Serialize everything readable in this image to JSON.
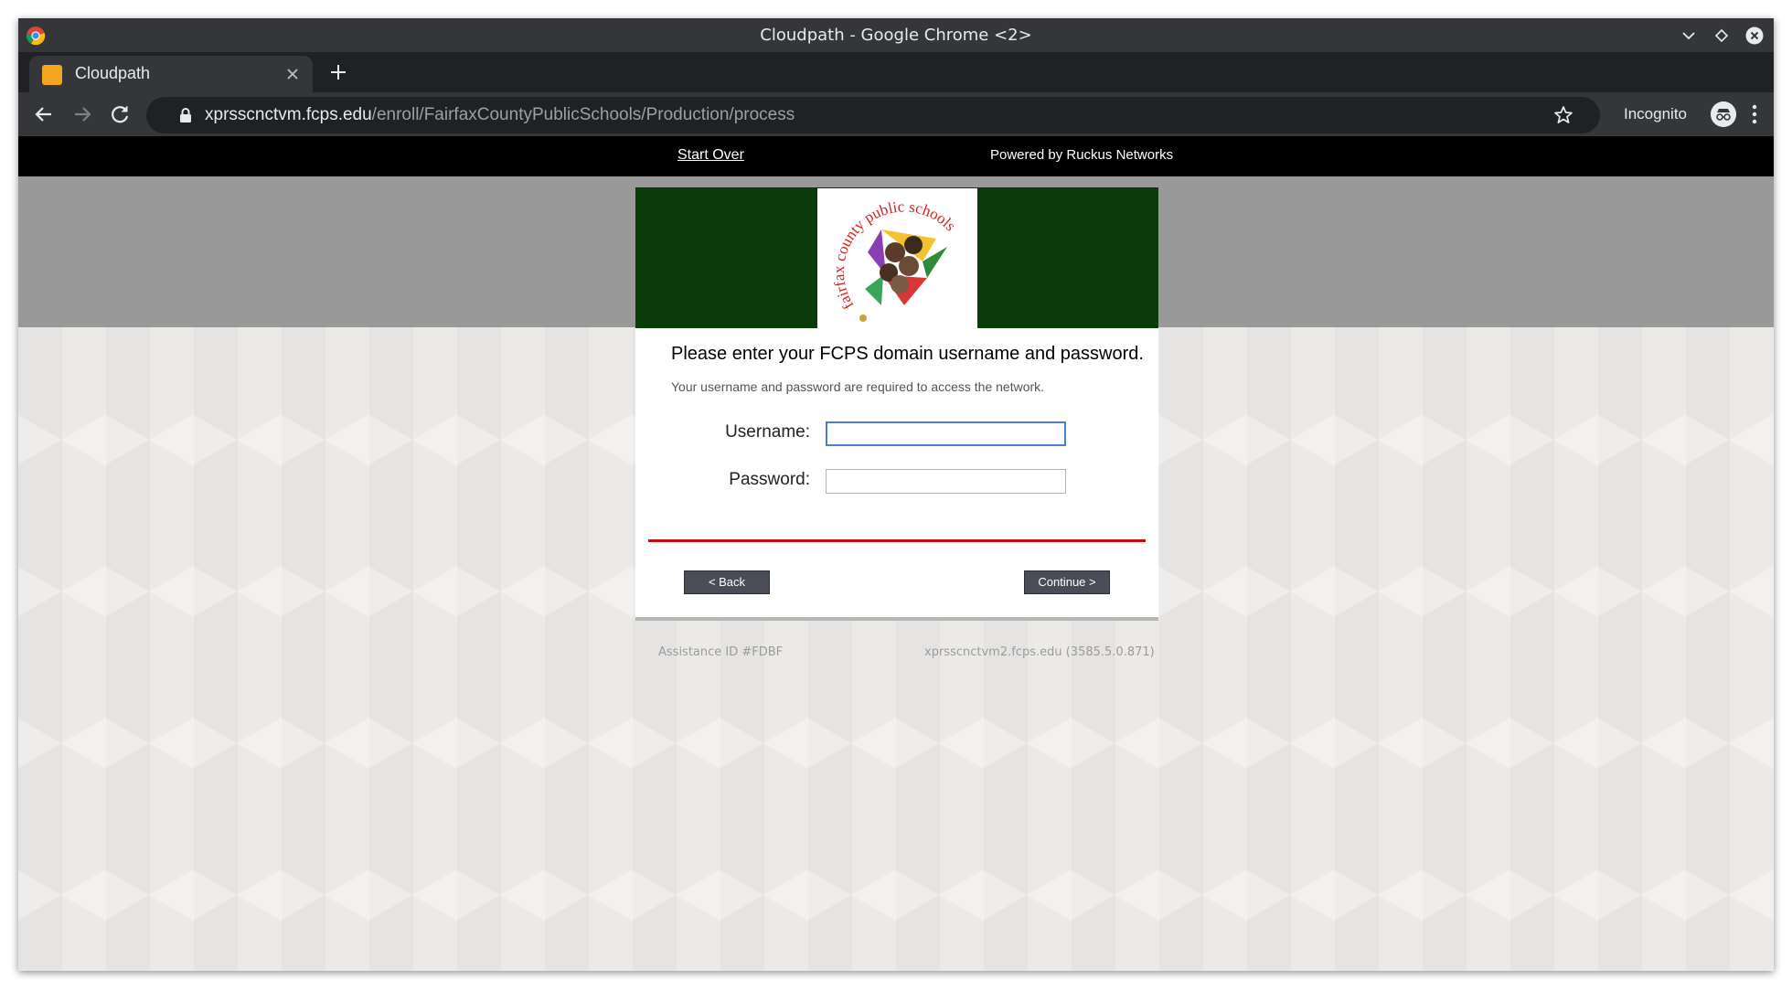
{
  "window": {
    "title": "Cloudpath - Google Chrome <2>"
  },
  "tab": {
    "title": "Cloudpath",
    "favicon": "cloudpath-favicon"
  },
  "toolbar": {
    "url_host": "xprsscnctvm.fcps.edu",
    "url_path": "/enroll/FairfaxCountyPublicSchools/Production/process",
    "incognito_label": "Incognito"
  },
  "page": {
    "start_over": "Start Over",
    "powered_by": "Powered by Ruckus Networks",
    "logo_text": "fairfax county public schools",
    "heading": "Please enter your FCPS domain username and password.",
    "subheading": "Your username and password are required to access the network.",
    "username_label": "Username:",
    "password_label": "Password:",
    "username_value": "",
    "password_value": "",
    "back_button": "< Back",
    "continue_button": "Continue >",
    "assistance_id": "Assistance ID #FDBF",
    "server_info": "xprsscnctvm2.fcps.edu (3585.5.0.871)"
  },
  "colors": {
    "banner": "#0b3a0b",
    "divider": "#c30d12",
    "button": "#4a4d57",
    "top_bar": "#000000",
    "gray_band": "#999999"
  }
}
